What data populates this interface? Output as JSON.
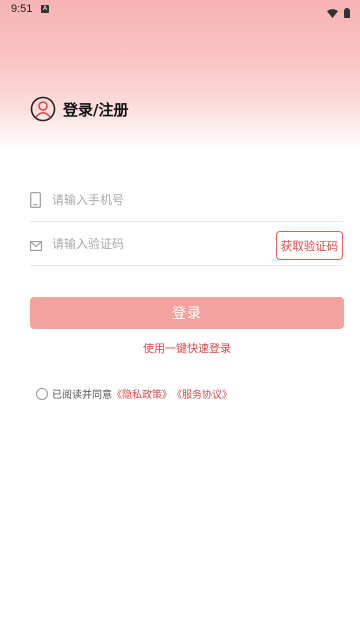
{
  "status_bar": {
    "time": "9:51",
    "notification_icon_letter": "A"
  },
  "header": {
    "title": "登录/注册",
    "gradient_top_color": "#f7b3b3"
  },
  "form": {
    "phone_placeholder": "请输入手机号",
    "code_placeholder": "请输入验证码",
    "get_code_label": "获取验证码",
    "login_label": "登录",
    "quick_login_label": "使用一键快速登录"
  },
  "agreement": {
    "prefix": "已阅读并同意",
    "privacy_link": "《隐私政策》",
    "service_link": "《服务协议》"
  },
  "colors": {
    "accent": "#d94a4a",
    "login_button": "#f3a29f"
  }
}
